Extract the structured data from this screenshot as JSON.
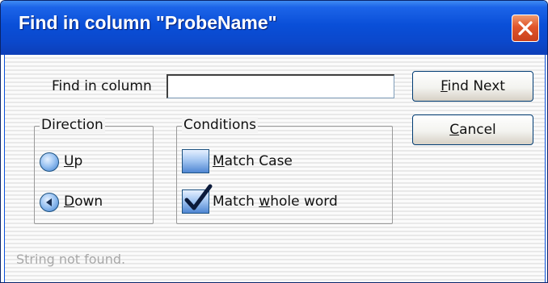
{
  "window": {
    "title": "Find in column \"ProbeName\""
  },
  "find": {
    "label": "Find in column",
    "value": ""
  },
  "buttons": {
    "find_next": {
      "mnemonic": "F",
      "rest": "ind Next"
    },
    "cancel": {
      "mnemonic": "C",
      "rest": "ancel"
    }
  },
  "direction": {
    "legend": "Direction",
    "up": {
      "mnemonic": "U",
      "rest": "p",
      "selected": false
    },
    "down": {
      "mnemonic": "D",
      "rest": "own",
      "selected": true
    }
  },
  "conditions": {
    "legend": "Conditions",
    "match_case": {
      "mnemonic": "M",
      "rest": "atch Case",
      "checked": false
    },
    "match_whole_word": {
      "prefix": "Match ",
      "mnemonic": "w",
      "rest": "hole word",
      "checked": true
    }
  },
  "status": {
    "text": "String not found."
  },
  "colors": {
    "title_bar": "#0a4fd8",
    "close_button": "#e0552b",
    "radio_fill": "#9cc4f2"
  },
  "icons": {
    "close": "close-x-icon",
    "radio_selected": "radio-dot-icon",
    "checkmark": "checkmark-icon"
  }
}
